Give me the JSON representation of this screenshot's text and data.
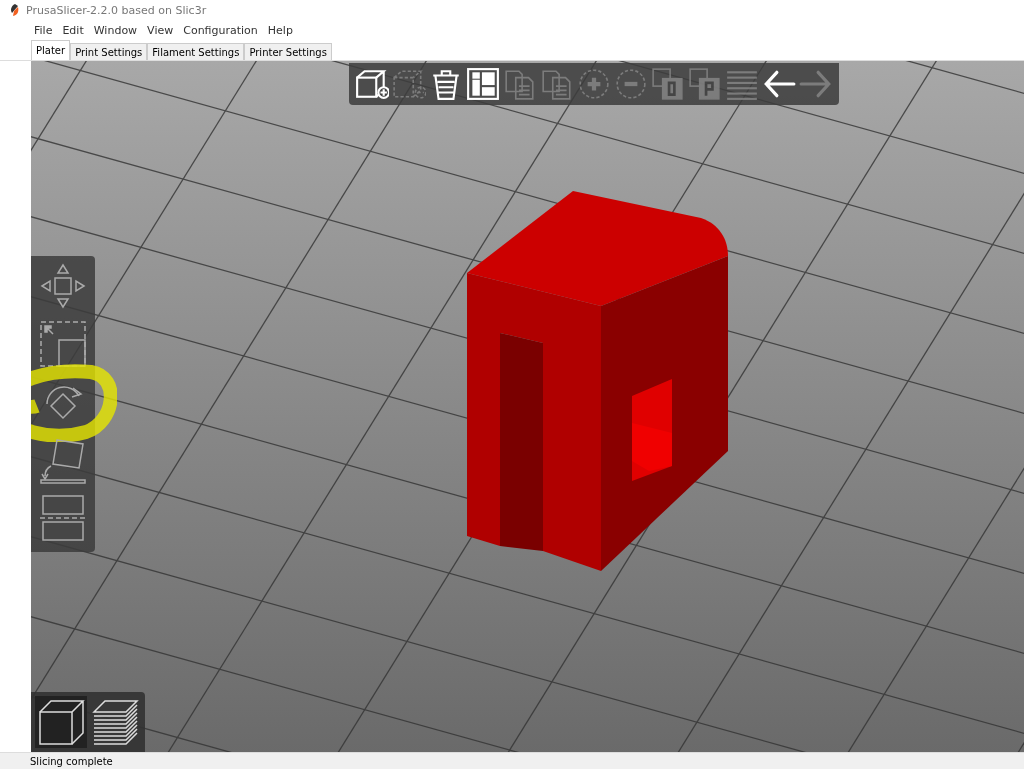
{
  "window": {
    "title": "PrusaSlicer-2.2.0 based on Slic3r"
  },
  "menu": [
    "File",
    "Edit",
    "Window",
    "View",
    "Configuration",
    "Help"
  ],
  "tabs": [
    {
      "label": "Plater",
      "selected": true
    },
    {
      "label": "Print Settings",
      "selected": false
    },
    {
      "label": "Filament Settings",
      "selected": false
    },
    {
      "label": "Printer Settings",
      "selected": false
    }
  ],
  "top_toolbar": [
    {
      "kind": "add",
      "disabled": false
    },
    {
      "kind": "delete",
      "disabled": true
    },
    {
      "kind": "delete-all",
      "disabled": false
    },
    {
      "kind": "arrange",
      "disabled": false
    },
    {
      "kind": "copy",
      "disabled": true
    },
    {
      "kind": "paste",
      "disabled": true
    },
    {
      "kind": "instance-add",
      "disabled": true
    },
    {
      "kind": "instance-remove",
      "disabled": true
    },
    {
      "kind": "split-objects",
      "disabled": true
    },
    {
      "kind": "split-parts",
      "disabled": true
    },
    {
      "kind": "layers",
      "disabled": true
    },
    {
      "kind": "undo",
      "disabled": false
    },
    {
      "kind": "redo",
      "disabled": true
    }
  ],
  "gizmos": [
    {
      "kind": "move"
    },
    {
      "kind": "scale"
    },
    {
      "kind": "rotate",
      "highlighted": true
    },
    {
      "kind": "place"
    },
    {
      "kind": "cut"
    }
  ],
  "view_toolbar": [
    {
      "kind": "model",
      "selected": true
    },
    {
      "kind": "preview",
      "selected": false
    }
  ],
  "status_bar": {
    "text": "Slicing complete"
  }
}
